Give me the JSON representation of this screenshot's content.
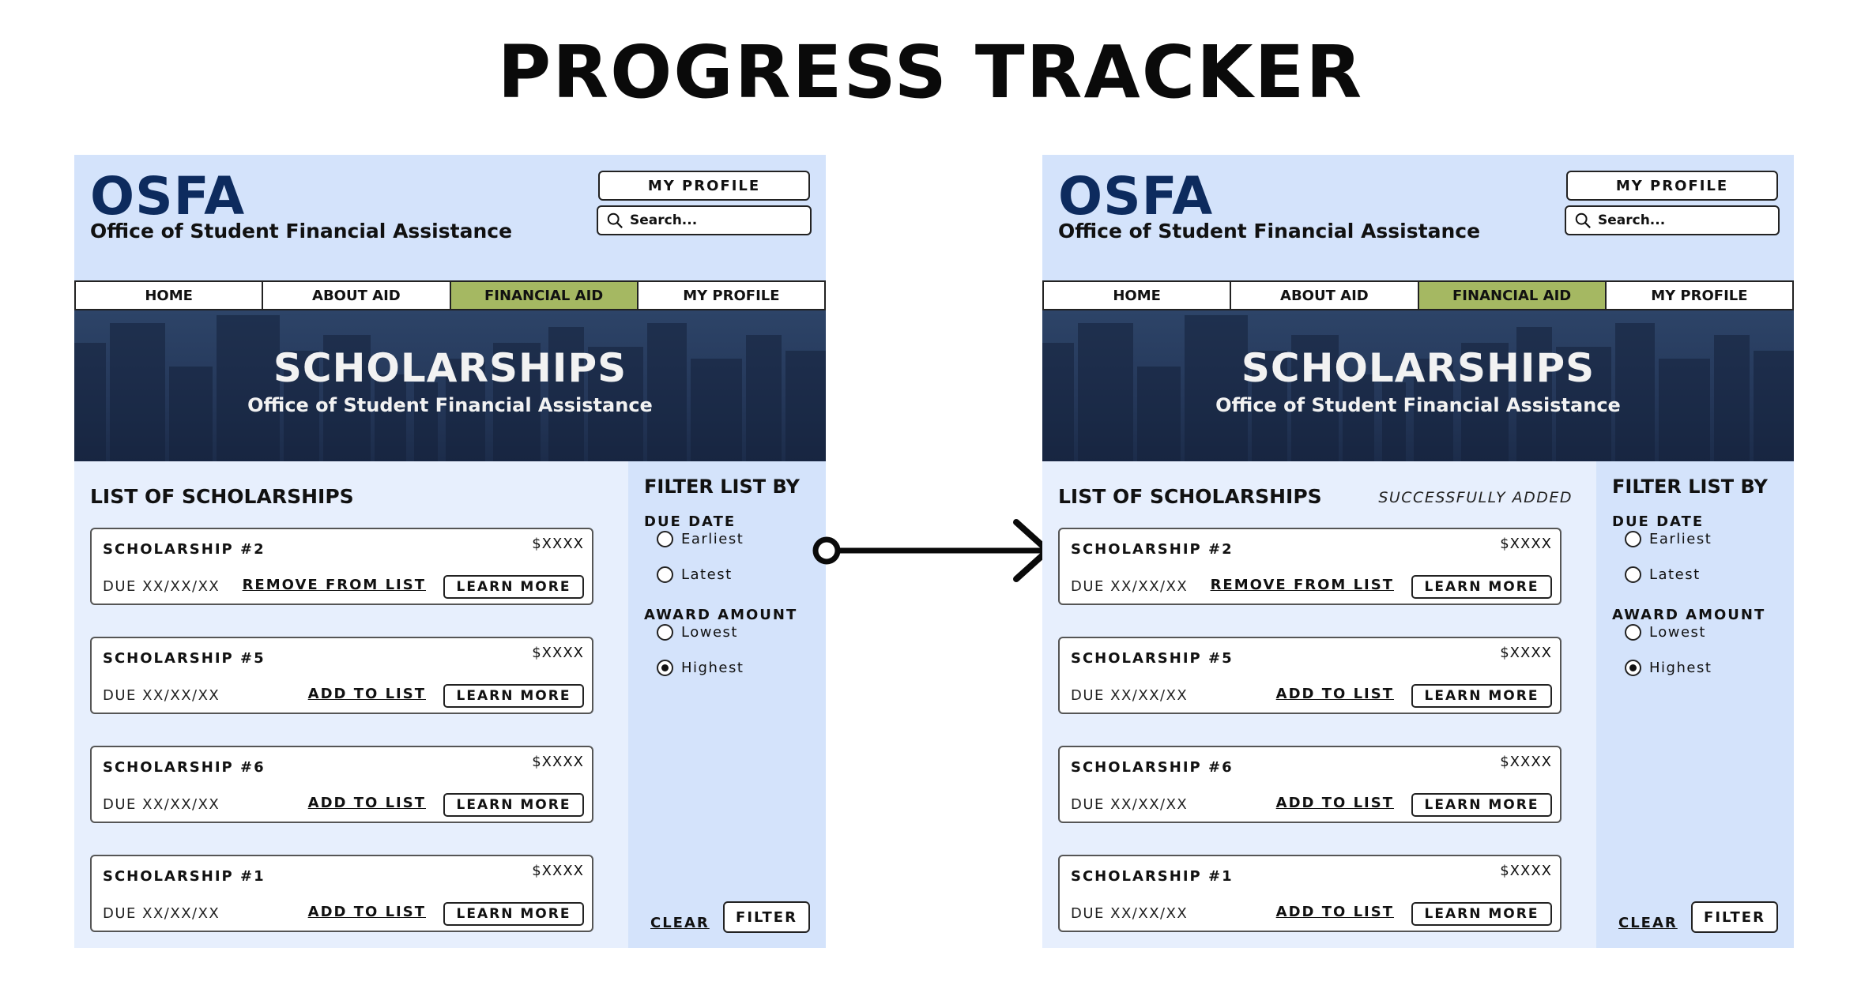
{
  "page": {
    "title": "PROGRESS TRACKER"
  },
  "colors": {
    "brand_navy": "#0d2b5e",
    "panel_bg": "#d4e3fb",
    "list_bg": "#e7effd",
    "nav_active": "#a5b862"
  },
  "header": {
    "logo": "OSFA",
    "subtitle": "Office of Student Financial Assistance",
    "profile_button": "MY PROFILE",
    "search_placeholder": "Search..."
  },
  "nav": [
    "HOME",
    "ABOUT AID",
    "FINANCIAL AID",
    "MY PROFILE"
  ],
  "nav_active_index": 2,
  "hero": {
    "title": "SCHOLARSHIPS",
    "subtitle": "Office of Student Financial Assistance"
  },
  "list": {
    "title": "LIST OF SCHOLARSHIPS",
    "learn_more": "LEARN MORE",
    "items": [
      {
        "name": "SCHOLARSHIP #2",
        "amount": "$XXXX",
        "due": "DUE XX/XX/XX",
        "action": "REMOVE FROM LIST"
      },
      {
        "name": "SCHOLARSHIP #5",
        "amount": "$XXXX",
        "due": "DUE XX/XX/XX",
        "action": "ADD TO LIST"
      },
      {
        "name": "SCHOLARSHIP #6",
        "amount": "$XXXX",
        "due": "DUE XX/XX/XX",
        "action": "ADD TO LIST"
      },
      {
        "name": "SCHOLARSHIP #1",
        "amount": "$XXXX",
        "due": "DUE XX/XX/XX",
        "action": "ADD TO LIST"
      }
    ]
  },
  "filter": {
    "title": "FILTER LIST BY",
    "due_date_label": "DUE DATE",
    "due_options": [
      "Earliest",
      "Latest"
    ],
    "award_label": "AWARD AMOUNT",
    "award_options": [
      "Lowest",
      "Highest"
    ],
    "award_selected": "Highest",
    "clear": "CLEAR",
    "filter_button": "FILTER"
  },
  "after_state": {
    "status": "SUCCESSFULLY ADDED"
  },
  "icons": {
    "search": "search-icon",
    "arrow": "arrow-right-icon"
  }
}
